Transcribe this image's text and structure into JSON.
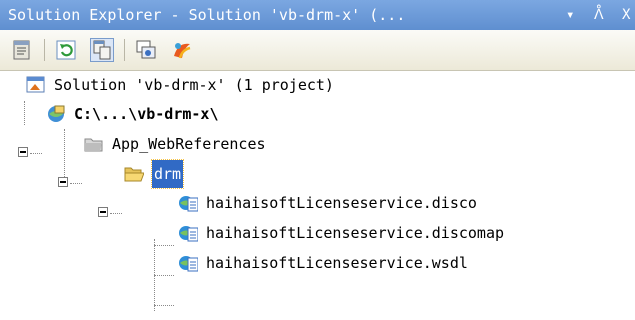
{
  "window": {
    "title": "Solution Explorer - Solution 'vb-drm-x'  (... ",
    "dropdown_glyph": "▾",
    "pin_glyph": "ᐰ",
    "close_glyph": "X"
  },
  "toolbar": {
    "buttons": [
      {
        "icon": "properties-icon"
      },
      {
        "icon": "refresh-icon"
      },
      {
        "icon": "nest-related-files-icon",
        "active": true
      },
      {
        "icon": "view-class-diagram-icon"
      },
      {
        "icon": "asp-net-configuration-icon"
      }
    ]
  },
  "tree": {
    "solution": "Solution 'vb-drm-x' (1 project)",
    "project": "C:\\...\\vb-drm-x\\",
    "folder": "App_WebReferences",
    "selected_folder": "drm",
    "files": [
      "haihaisoftLicenseservice.disco",
      "haihaisoftLicenseservice.discomap",
      "haihaisoftLicenseservice.wsdl"
    ]
  },
  "colors": {
    "titlebar": "#6f9bd9",
    "selection": "#316ac5"
  }
}
